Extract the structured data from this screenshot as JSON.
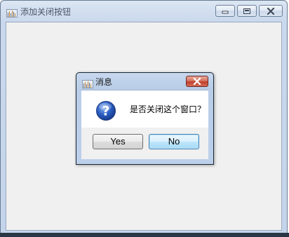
{
  "main_window": {
    "title": "添加关闭按钮",
    "icon": "app-icon",
    "caption_buttons": [
      "minimize-icon",
      "maximize-icon",
      "close-icon"
    ]
  },
  "dialog": {
    "title": "消息",
    "icon": "question-icon",
    "message": "是否关闭这个窗口？",
    "buttons": {
      "yes": "Yes",
      "no": "No"
    },
    "default_button": "No"
  },
  "colors": {
    "client_background": "#f0f0f0",
    "titlebar": "#c9d8ec",
    "close_red": "#c0402b",
    "focus_blue": "#3c7fb1"
  }
}
